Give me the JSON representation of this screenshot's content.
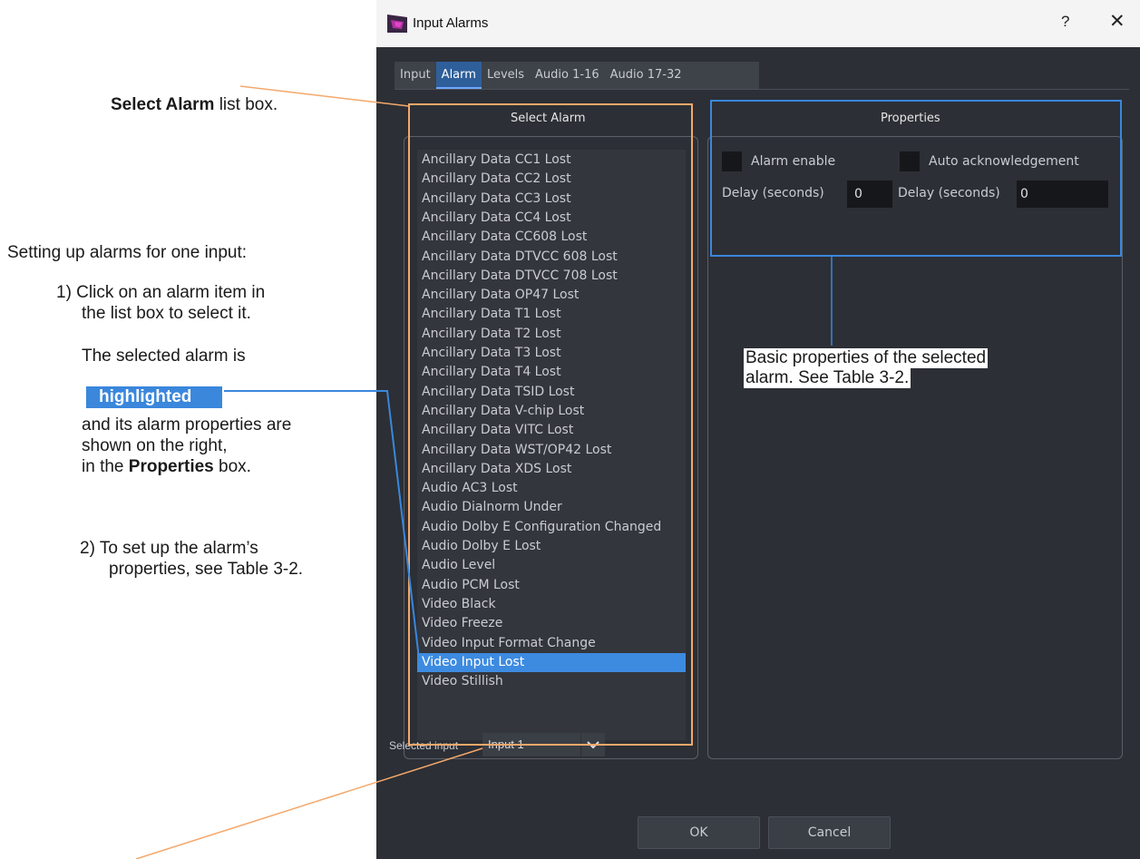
{
  "dialog": {
    "title": "Input Alarms",
    "help_label": "?",
    "close_label": "✕",
    "tabs": [
      "Input",
      "Alarm",
      "Levels",
      "Audio 1-16",
      "Audio 17-32"
    ],
    "active_tab": "Alarm"
  },
  "select_alarm": {
    "title": "Select Alarm",
    "items": [
      "Ancillary Data CC1 Lost",
      "Ancillary Data CC2 Lost",
      "Ancillary Data CC3 Lost",
      "Ancillary Data CC4 Lost",
      "Ancillary Data CC608 Lost",
      "Ancillary Data DTVCC 608 Lost",
      "Ancillary Data DTVCC 708 Lost",
      "Ancillary Data OP47 Lost",
      "Ancillary Data T1 Lost",
      "Ancillary Data T2 Lost",
      "Ancillary Data T3 Lost",
      "Ancillary Data T4 Lost",
      "Ancillary Data TSID Lost",
      "Ancillary Data V-chip Lost",
      "Ancillary Data VITC Lost",
      "Ancillary Data WST/OP42 Lost",
      "Ancillary Data XDS Lost",
      "Audio AC3 Lost",
      "Audio Dialnorm Under",
      "Audio Dolby E Configuration Changed",
      "Audio Dolby E Lost",
      "Audio Level",
      "Audio PCM Lost",
      "Video Black",
      "Video Freeze",
      "Video Input Format Change",
      "Video Input Lost",
      "Video Stillish"
    ],
    "selected_index": 26
  },
  "properties": {
    "title": "Properties",
    "alarm_enable_label": "Alarm enable",
    "auto_ack_label": "Auto acknowledgement",
    "delay_label_1": "Delay (seconds)",
    "delay_value_1": "0",
    "delay_label_2": "Delay (seconds)",
    "delay_value_2": "0"
  },
  "footer": {
    "selected_input_label": "Selected input",
    "selected_input_value": "Input 1",
    "ok_label": "OK",
    "cancel_label": "Cancel"
  },
  "annotations": {
    "select_alarm_bold": "Select Alarm",
    "select_alarm_rest": " list box.",
    "setup_heading": "Setting up alarms for one input:",
    "step1_line1": "1) Click on an alarm item in",
    "step1_line2": "the list box to select it.",
    "selected_line": "The selected alarm is",
    "highlighted_tag": "highlighted",
    "props_line1": "and its alarm properties are",
    "props_line2": "shown on the right,",
    "props_line3_pre": "in the ",
    "props_line3_bold": "Properties",
    "props_line3_post": " box.",
    "step2_line1": "2) To set up the alarm’s",
    "step2_line2": "properties, see Table 3-2.",
    "basic_props_line1": "Basic properties of the selected",
    "basic_props_line2": "alarm. See Table 3-2."
  },
  "colors": {
    "orange_callout": "#f4a86b",
    "blue_callout": "#3a87dc",
    "selection": "#3d8be0"
  }
}
